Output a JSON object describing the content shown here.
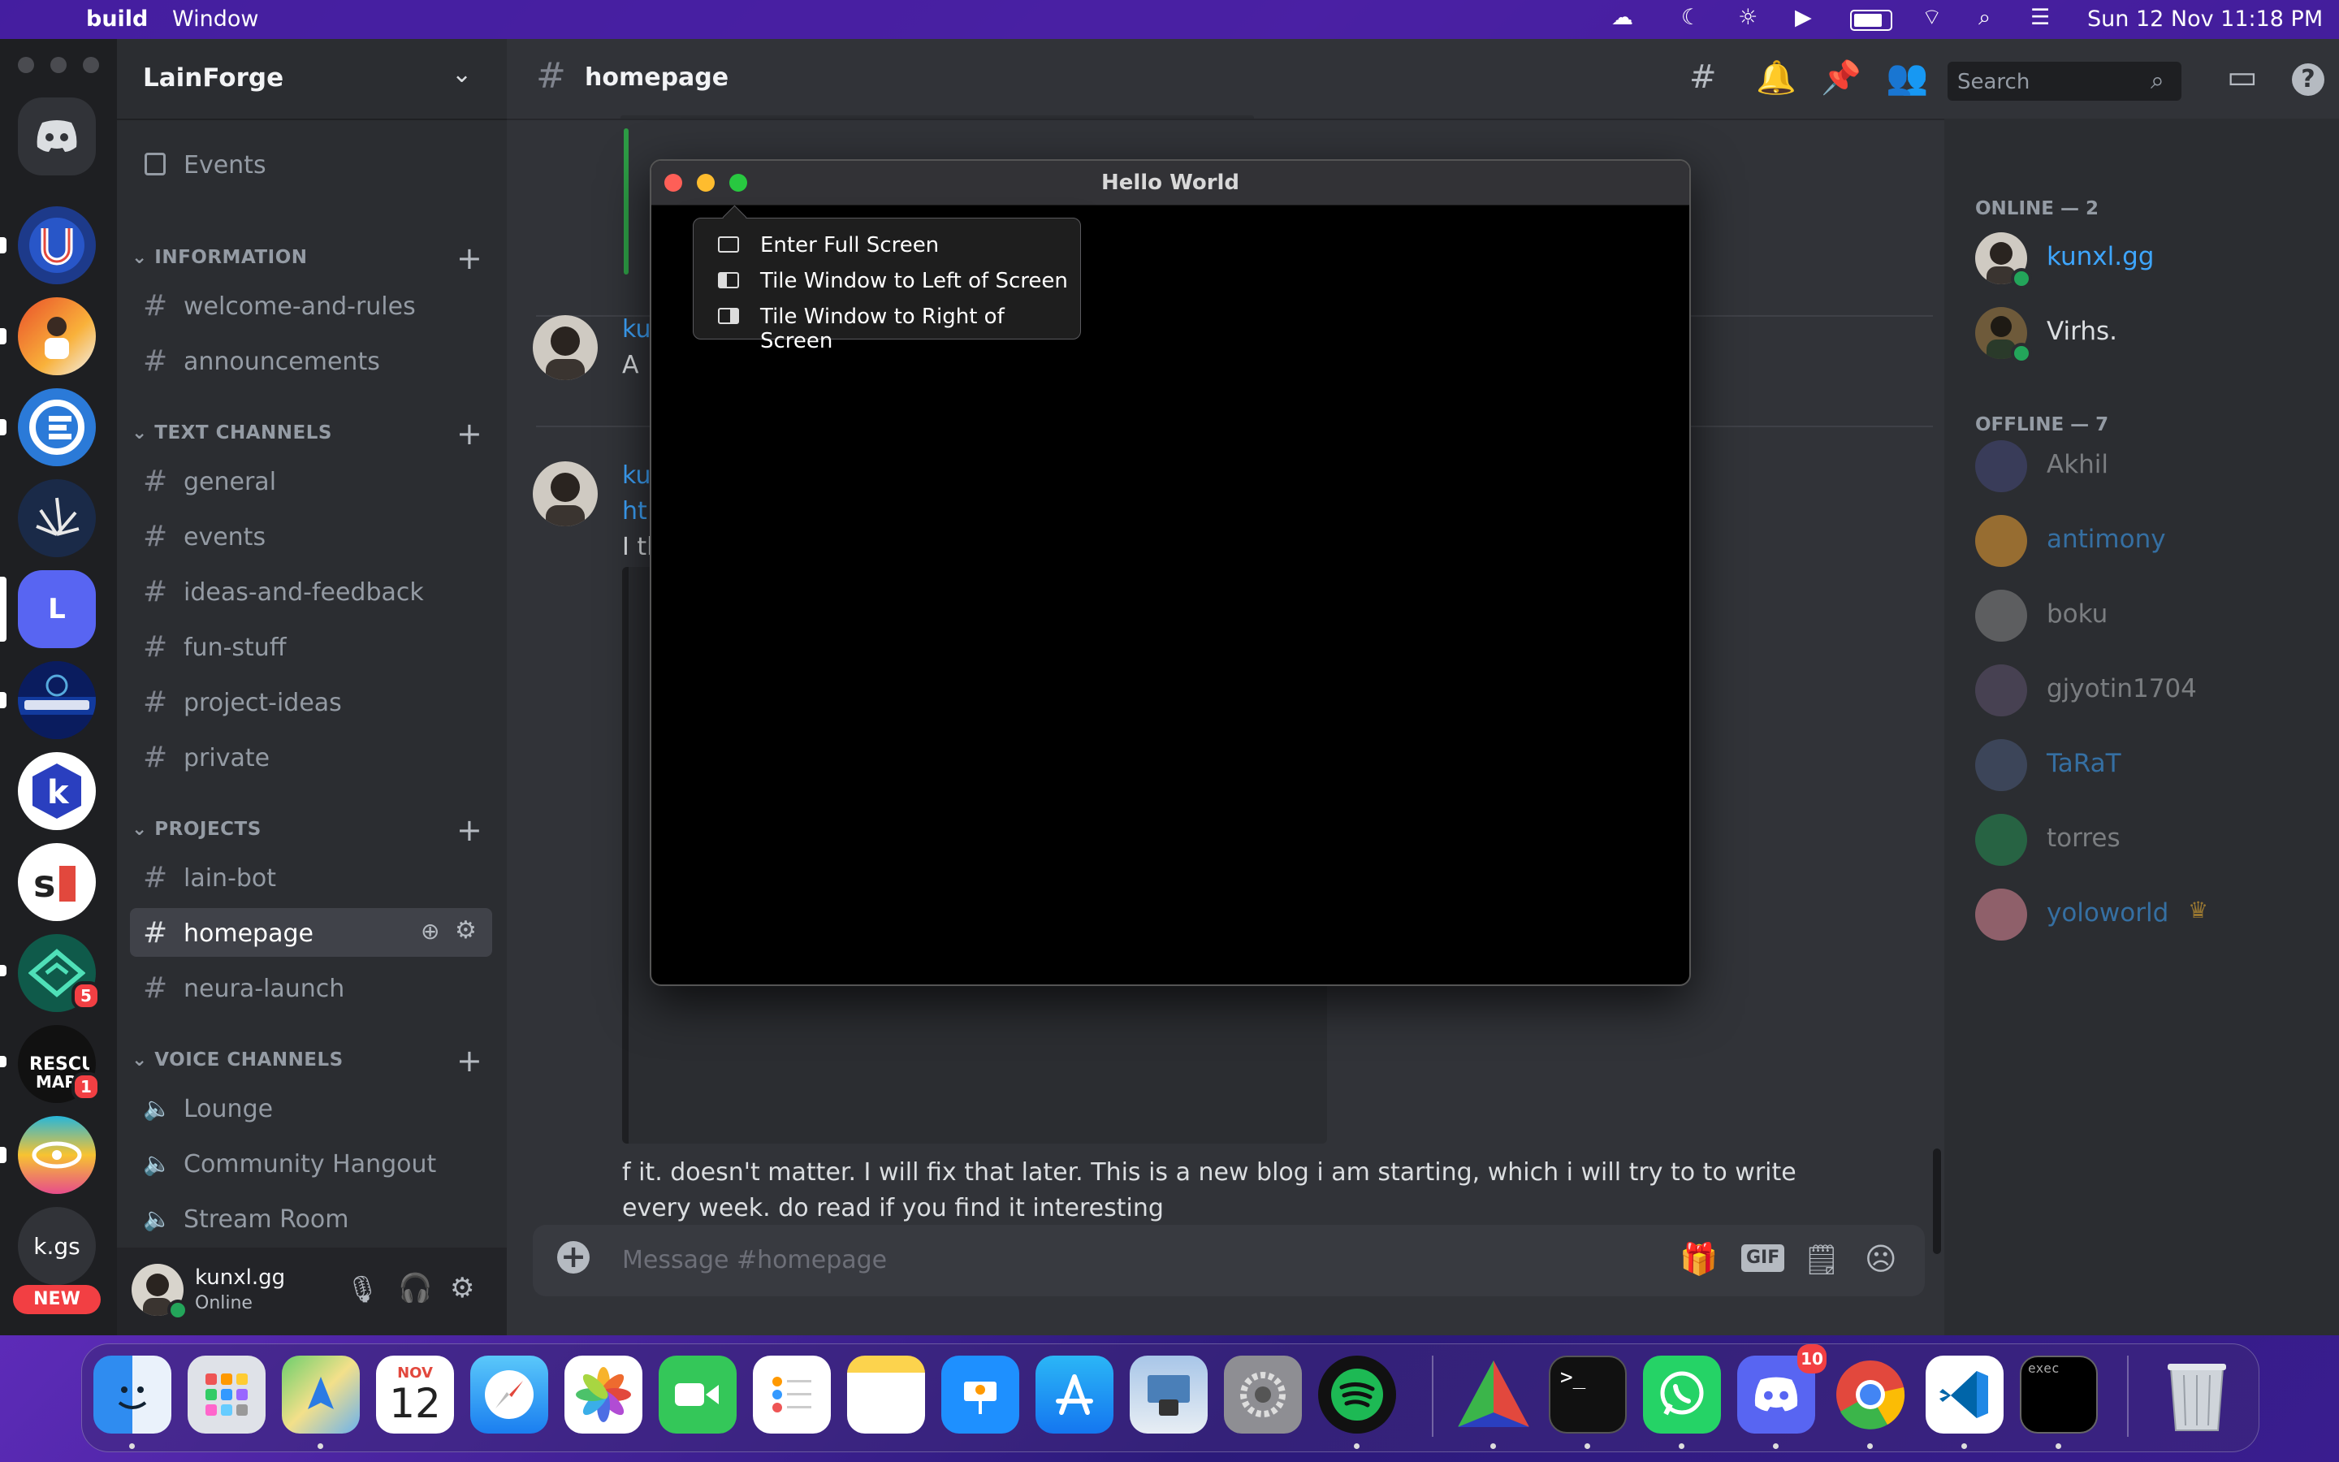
{
  "menubar": {
    "app": "build",
    "window_menu": "Window",
    "datetime": "Sun 12 Nov  11:18 PM"
  },
  "server": {
    "name": "LainForge"
  },
  "rail": {
    "l_label": "L",
    "kgs_label": "k.gs",
    "new_label": "NEW",
    "badge1": "5",
    "badge2": "1"
  },
  "sidebar": {
    "events": "Events",
    "categories": {
      "information": "INFORMATION",
      "text": "TEXT CHANNELS",
      "projects": "PROJECTS",
      "voice": "VOICE CHANNELS"
    },
    "channels": [
      "welcome-and-rules",
      "announcements",
      "general",
      "events",
      "ideas-and-feedback",
      "fun-stuff",
      "project-ideas",
      "private",
      "lain-bot",
      "homepage",
      "neura-launch"
    ],
    "voice": [
      "Lounge",
      "Community Hangout",
      "Stream Room"
    ]
  },
  "user": {
    "name": "kunxl.gg",
    "status": "Online"
  },
  "channel": {
    "name": "homepage"
  },
  "search": {
    "placeholder": "Search"
  },
  "messages": {
    "author1": "ku",
    "text1": "A",
    "author2": "ku",
    "link2": "ht",
    "line2": "I tl",
    "body": "f it. doesn't matter. I will fix that later. This is a new blog i am starting, which i will try to to write every week. do read if you find it interesting"
  },
  "composer": {
    "placeholder": "Message #homepage",
    "gif": "GIF"
  },
  "members": {
    "online_header": "ONLINE — 2",
    "offline_header": "OFFLINE — 7",
    "online": [
      {
        "name": "kunxl.gg",
        "color": "#3ea6ff"
      },
      {
        "name": "Virhs.",
        "color": "#dbdee1"
      }
    ],
    "offline": [
      {
        "name": "Akhil",
        "color": "#8a8e94"
      },
      {
        "name": "antimony",
        "color": "#2f6fa8"
      },
      {
        "name": "boku",
        "color": "#8a8e94"
      },
      {
        "name": "gjyotin1704",
        "color": "#8a8e94"
      },
      {
        "name": "TaRaT",
        "color": "#2f6fa8"
      },
      {
        "name": "torres",
        "color": "#8a8e94"
      },
      {
        "name": "yoloworld",
        "color": "#2f6fa8"
      }
    ]
  },
  "hello_window": {
    "title": "Hello World"
  },
  "zoom_menu": [
    "Enter Full Screen",
    "Tile Window to Left of Screen",
    "Tile Window to Right of Screen"
  ],
  "dock": {
    "calendar_month": "NOV",
    "calendar_day": "12",
    "discord_badge": "10",
    "exec_label": "exec"
  }
}
